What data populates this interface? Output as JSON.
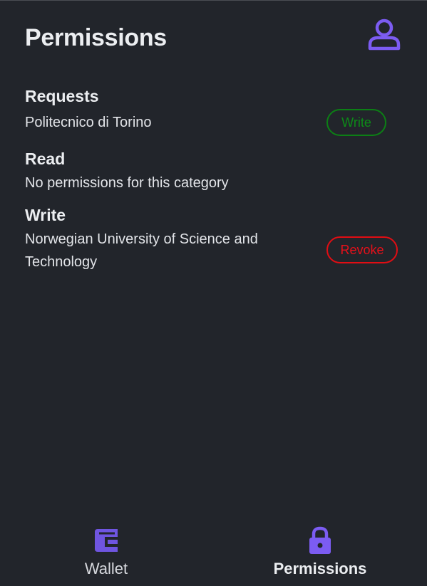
{
  "header": {
    "title": "Permissions",
    "profile_icon": "user-icon"
  },
  "sections": {
    "requests": {
      "title": "Requests",
      "items": [
        {
          "name": "Politecnico di Torino",
          "action_label": "Write",
          "action_color": "#0c8c17"
        }
      ]
    },
    "read": {
      "title": "Read",
      "empty_text": "No permissions for this category"
    },
    "write": {
      "title": "Write",
      "items": [
        {
          "name": "Norwegian University of Science and Technology",
          "action_label": "Revoke",
          "action_color": "#e8101a"
        }
      ]
    }
  },
  "bottom_nav": {
    "items": [
      {
        "label": "Wallet",
        "icon": "wallet-icon",
        "active": false
      },
      {
        "label": "Permissions",
        "icon": "lock-icon",
        "active": true
      }
    ]
  },
  "colors": {
    "accent": "#7c5cf2",
    "background": "#22252b"
  }
}
